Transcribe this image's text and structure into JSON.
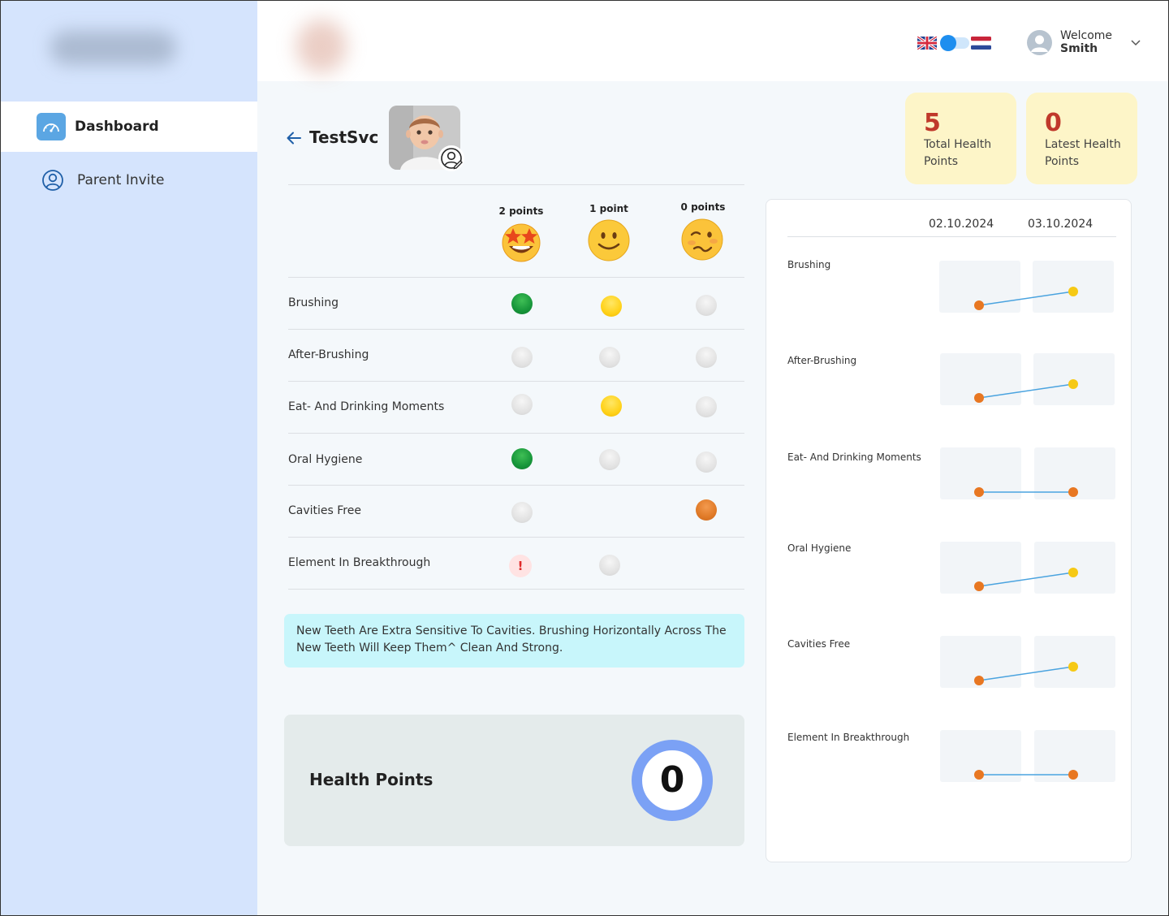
{
  "colors": {
    "sidebar_bg": "#d5e4fd",
    "accent": "#5ba6e3",
    "stat_card_bg": "#fdf5c8",
    "stat_value": "#c0392b",
    "tip_bg": "#c8f6fb",
    "ring": "#7ba1f5",
    "point_orange": "#e87722",
    "point_yellow": "#f6c915",
    "line_blue": "#4aa3df"
  },
  "sidebar": {
    "items": [
      {
        "label": "Dashboard",
        "icon": "speedometer-icon",
        "active": true
      },
      {
        "label": "Parent Invite",
        "icon": "user-circle-icon",
        "active": false
      }
    ]
  },
  "header": {
    "welcome": "Welcome",
    "username": "Smith",
    "language_left": "uk-flag-icon",
    "language_right": "netherlands-flag-icon"
  },
  "child": {
    "name": "TestSvc"
  },
  "stats": [
    {
      "value": "5",
      "label": "Total Health Points"
    },
    {
      "value": "0",
      "label": "Latest Health Points"
    }
  ],
  "table": {
    "columns": [
      {
        "label": "2 points",
        "emoji": "star-struck-emoji-icon"
      },
      {
        "label": "1 point",
        "emoji": "slightly-smiling-emoji-icon"
      },
      {
        "label": "0 points",
        "emoji": "woozy-emoji-icon"
      }
    ],
    "rows": [
      {
        "label": "Brushing",
        "cells": [
          "green",
          "yellow",
          "gray"
        ]
      },
      {
        "label": "After-Brushing",
        "cells": [
          "gray",
          "gray",
          "gray"
        ]
      },
      {
        "label": "Eat- And Drinking Moments",
        "cells": [
          "gray",
          "yellow",
          "gray"
        ]
      },
      {
        "label": "Oral Hygiene",
        "cells": [
          "green",
          "gray",
          "gray"
        ]
      },
      {
        "label": "Cavities Free",
        "cells": [
          "gray",
          "none",
          "orange"
        ]
      },
      {
        "label": "Element In Breakthrough",
        "cells": [
          "alert",
          "gray",
          "none"
        ]
      }
    ],
    "alert_glyph": "!"
  },
  "tip": {
    "text": "New Teeth Are Extra Sensitive To Cavities. Brushing Horizontally Across The New Teeth Will Keep Them^ Clean And Strong."
  },
  "health_points": {
    "label": "Health Points",
    "value": "0"
  },
  "chart_data": {
    "type": "line",
    "dates": [
      "02.10.2024",
      "03.10.2024"
    ],
    "series": [
      {
        "name": "Brushing",
        "values": [
          0,
          1
        ],
        "colors": [
          "orange",
          "yellow"
        ]
      },
      {
        "name": "After-Brushing",
        "values": [
          0,
          1
        ],
        "colors": [
          "orange",
          "yellow"
        ]
      },
      {
        "name": "Eat- And Drinking Moments",
        "values": [
          0,
          0
        ],
        "colors": [
          "orange",
          "orange"
        ]
      },
      {
        "name": "Oral Hygiene",
        "values": [
          0,
          1
        ],
        "colors": [
          "orange",
          "yellow"
        ]
      },
      {
        "name": "Cavities Free",
        "values": [
          0,
          1
        ],
        "colors": [
          "orange",
          "yellow"
        ]
      },
      {
        "name": "Element In Breakthrough",
        "values": [
          0,
          0
        ],
        "colors": [
          "orange",
          "orange"
        ]
      }
    ]
  }
}
